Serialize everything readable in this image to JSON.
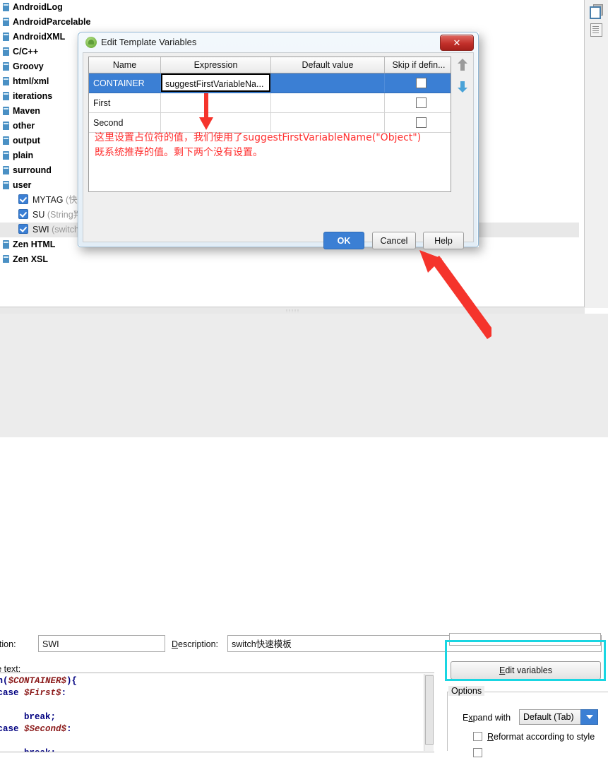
{
  "app": {
    "tree_groups": [
      "AndroidLog",
      "AndroidParcelable",
      "AndroidXML",
      "C/C++",
      "Groovy",
      "html/xml",
      "iterations",
      "Maven",
      "other",
      "output",
      "plain",
      "surround",
      "user"
    ],
    "tree_leaves": [
      {
        "name": "MYTAG",
        "desc": "(快速生",
        "checked": true,
        "selected": false
      },
      {
        "name": "SU",
        "desc": "(String判空",
        "checked": true,
        "selected": false
      },
      {
        "name": "SWI",
        "desc": "(switch快",
        "checked": true,
        "selected": true
      }
    ],
    "tree_groups_tail": [
      "Zen HTML",
      "Zen XSL"
    ],
    "right_strip": {
      "copy_icon": "copy-icon",
      "doc_icon": "document-icon"
    }
  },
  "detail": {
    "abbreviation_label": "eviation:",
    "abbreviation_value": "SWI",
    "description_label_prefix": "D",
    "description_label_rest": "escription:",
    "description_value": "switch快速模板",
    "template_text_label": "late text:",
    "code_lines": [
      "ch($CONTAINER$){",
      "  case $First$:",
      "",
      "      break;",
      "  case $Second$:",
      "",
      "      break;"
    ],
    "edit_variables_field_value": "",
    "edit_variables_button_prefix": "E",
    "edit_variables_button_rest": "dit variables",
    "options": {
      "legend": "Options",
      "expand_with_label_prefix": "E",
      "expand_with_label_mid": "x",
      "expand_with_label_rest": "pand with",
      "expand_with_value": "Default (Tab)",
      "reformat_prefix": "R",
      "reformat_rest": "eformat according to style",
      "reformat_checked": false,
      "partial_row_visible": true
    },
    "highlight_color": "#19d6e2"
  },
  "dialog": {
    "title": "Edit Template Variables",
    "icon": "android-studio-icon",
    "close_label": "✕",
    "columns": [
      "Name",
      "Expression",
      "Default value",
      "Skip if defin..."
    ],
    "rows": [
      {
        "name": "CONTAINER",
        "expression": "suggestFirstVariableNa...",
        "default_value": "",
        "skip": false,
        "selected": true,
        "editing": true
      },
      {
        "name": "First",
        "expression": "",
        "default_value": "",
        "skip": false,
        "selected": false,
        "editing": false
      },
      {
        "name": "Second",
        "expression": "",
        "default_value": "",
        "skip": false,
        "selected": false,
        "editing": false
      }
    ],
    "note": "这里设置占位符的值，我们使用了suggestFirstVariableName(\"Object\")\n既系统推荐的值。剩下两个没有设置。",
    "note_color": "#ff2f2f",
    "move_up_icon": "arrow-up-icon",
    "move_down_icon": "arrow-down-icon",
    "buttons": {
      "ok": "OK",
      "cancel": "Cancel",
      "help": "Help"
    },
    "accent_color": "#3b7fd4"
  },
  "annotations": {
    "arrow_color": "#f5342c",
    "small_arrow": "down-arrow-annotation",
    "big_arrow": "diagonal-arrow-annotation"
  }
}
